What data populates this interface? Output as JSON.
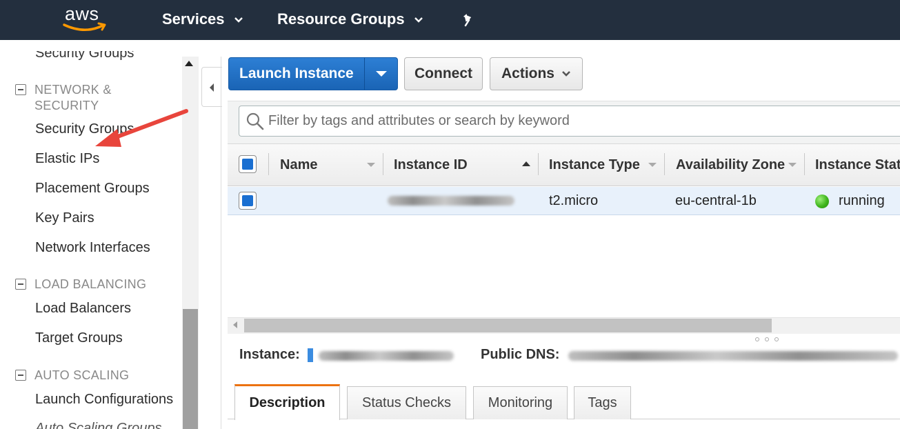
{
  "topbar": {
    "logo_text": "aws",
    "nav": [
      {
        "label": "Services"
      },
      {
        "label": "Resource Groups"
      }
    ],
    "pin_icon": "pin-icon"
  },
  "sidebar": {
    "partial_item": "Security Groups",
    "sections": [
      {
        "title": "NETWORK & SECURITY",
        "items": [
          "Security Groups",
          "Elastic IPs",
          "Placement Groups",
          "Key Pairs",
          "Network Interfaces"
        ]
      },
      {
        "title": "LOAD BALANCING",
        "items": [
          "Load Balancers",
          "Target Groups"
        ]
      },
      {
        "title": "AUTO SCALING",
        "items": [
          "Launch Configurations",
          "Auto Scaling Groups"
        ]
      }
    ]
  },
  "toolbar": {
    "launch_label": "Launch Instance",
    "connect_label": "Connect",
    "actions_label": "Actions"
  },
  "search": {
    "placeholder": "Filter by tags and attributes or search by keyword"
  },
  "table": {
    "columns": [
      "Name",
      "Instance ID",
      "Instance Type",
      "Availability Zone",
      "Instance State"
    ],
    "rows": [
      {
        "name": "",
        "instance_id": "",
        "instance_type": "t2.micro",
        "availability_zone": "eu-central-1b",
        "state": "running",
        "state_color": "#3fb51d"
      }
    ]
  },
  "details": {
    "instance_label": "Instance:",
    "public_dns_label": "Public DNS:"
  },
  "tabs": [
    {
      "label": "Description",
      "active": true
    },
    {
      "label": "Status Checks",
      "active": false
    },
    {
      "label": "Monitoring",
      "active": false
    },
    {
      "label": "Tags",
      "active": false
    }
  ],
  "colors": {
    "topbar_bg": "#232f3e",
    "primary_button": "#1a64b5",
    "accent_orange": "#ec7211",
    "annotation_arrow": "#e8453c"
  }
}
